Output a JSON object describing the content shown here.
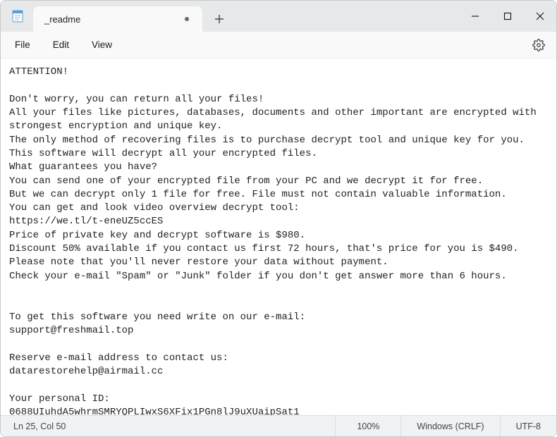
{
  "titlebar": {
    "tab_title": "_readme",
    "app_icon": "notepad-icon"
  },
  "menubar": {
    "items": [
      "File",
      "Edit",
      "View"
    ]
  },
  "editor": {
    "content": "ATTENTION!\n\nDon't worry, you can return all your files!\nAll your files like pictures, databases, documents and other important are encrypted with strongest encryption and unique key.\nThe only method of recovering files is to purchase decrypt tool and unique key for you.\nThis software will decrypt all your encrypted files.\nWhat guarantees you have?\nYou can send one of your encrypted file from your PC and we decrypt it for free.\nBut we can decrypt only 1 file for free. File must not contain valuable information.\nYou can get and look video overview decrypt tool:\nhttps://we.tl/t-eneUZ5ccES\nPrice of private key and decrypt software is $980.\nDiscount 50% available if you contact us first 72 hours, that's price for you is $490.\nPlease note that you'll never restore your data without payment.\nCheck your e-mail \"Spam\" or \"Junk\" folder if you don't get answer more than 6 hours.\n\n\nTo get this software you need write on our e-mail:\nsupport@freshmail.top\n\nReserve e-mail address to contact us:\ndatarestorehelp@airmail.cc\n\nYour personal ID:\n0688UIuhdA5whrmSMRYQPLIwxS6XFix1PGn8lJ9uXUaipSat1"
  },
  "statusbar": {
    "position": "Ln 25, Col 50",
    "zoom": "100%",
    "line_ending": "Windows (CRLF)",
    "encoding": "UTF-8"
  }
}
